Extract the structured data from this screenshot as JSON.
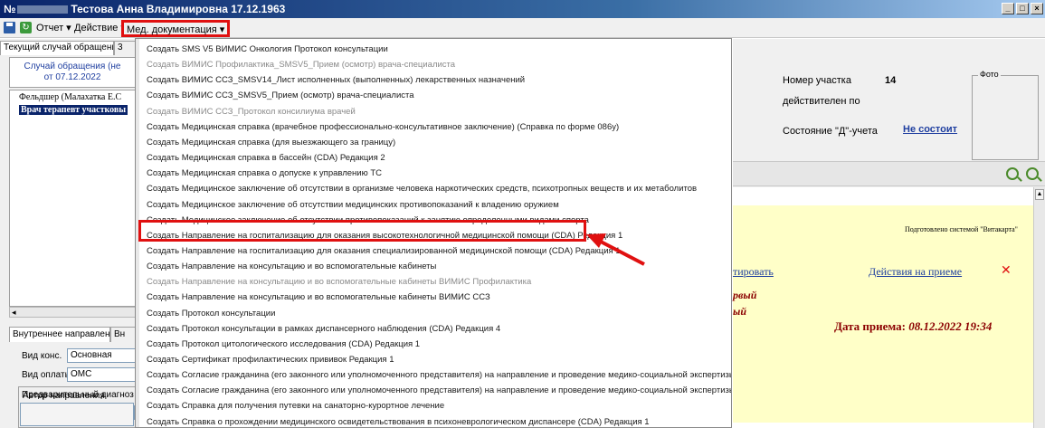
{
  "window": {
    "title_prefix": "№",
    "title_name": "Тестова Анна Владимировна 17.12.1963",
    "btn_min": "_",
    "btn_max": "□",
    "btn_close": "×"
  },
  "toolbar": {
    "report": "Отчет ▾",
    "action": "Действие ▾",
    "med_docs": "Мед. документация ▾",
    "refresh_glyph": "↻"
  },
  "left": {
    "tab_current": "Текущий случай обращения",
    "tab_current_2": "3",
    "case_line1": "Случай обращения (не",
    "case_line2": "от 07.12.2022",
    "tree_node1": "Фельдшер (Малахатка Е.С",
    "tree_node2": "Врач терапевт участковы",
    "hscroll_glyph": "◂",
    "tab_referral": "Внутреннее направление",
    "tab_referral_2": "Вн",
    "consult_type_label": "Вид конс.",
    "consult_type_value": "Основная",
    "payment_type_label": "Вид оплаты",
    "payment_type_value": "ОМС",
    "author_label": "Автор направления",
    "diagnosis_label": "Предварительный диагноз"
  },
  "right": {
    "district_label": "Номер участка",
    "district_value": "14",
    "valid_label": "действителен по",
    "d_status_label": "Состояние \"Д\"-учета",
    "d_status_value": "Не состоит",
    "photo_label": "Фото",
    "prepared_by": "Подготовлено системой \"Витакарта\"",
    "edit_link": "тировать",
    "actions_link": "Действия на приеме",
    "close_glyph": "✕",
    "primary_frag": "рвый",
    "frag2": "ый",
    "visit_date_label": "Дата приема:",
    "visit_date_value": "08.12.2022 19:34",
    "scroll_up_glyph": "▲"
  },
  "menu": {
    "items": [
      {
        "label": "Создать SMS V5 ВИМИС Онкология Протокол консультации",
        "disabled": false
      },
      {
        "label": "Создать ВИМИС Профилактика_SMSV5_Прием (осмотр) врача-специалиста",
        "disabled": true
      },
      {
        "label": "Создать ВИМИС ССЗ_SMSV14_Лист исполненных (выполненных) лекарственных назначений",
        "disabled": false
      },
      {
        "label": "Создать ВИМИС ССЗ_SMSV5_Прием (осмотр) врача-специалиста",
        "disabled": false
      },
      {
        "label": "Создать ВИМИС ССЗ_Протокол консилиума врачей",
        "disabled": true
      },
      {
        "label": "Создать Медицинская справка (врачебное профессионально-консультативное заключение) (Справка по форме 086у)",
        "disabled": false
      },
      {
        "label": "Создать Медицинская справка (для выезжающего за границу)",
        "disabled": false
      },
      {
        "label": "Создать Медицинская справка в бассейн (CDA) Редакция 2",
        "disabled": false
      },
      {
        "label": "Создать Медицинская справка о допуске к управлению ТС",
        "disabled": false
      },
      {
        "label": "Создать Медицинское заключение об отсутствии в организме человека наркотических средств, психотропных веществ и их метаболитов",
        "disabled": false
      },
      {
        "label": "Создать Медицинское заключение об отсутствии медицинских противопоказаний к владению оружием",
        "disabled": false
      },
      {
        "label": "Создать Медицинское заключение об отсутствии противопоказаний к занятию определенными видами спорта",
        "disabled": false
      },
      {
        "label": "Создать Направление на госпитализацию для оказания высокотехнологичной медицинской помощи (CDA) Редакция 1",
        "disabled": false
      },
      {
        "label": "Создать Направление на госпитализацию для оказания специализированной медицинской помощи (CDA) Редакция 1",
        "disabled": false
      },
      {
        "label": "Создать Направление на консультацию и во вспомогательные кабинеты",
        "disabled": false
      },
      {
        "label": "Создать Направление на консультацию и во вспомогательные кабинеты ВИМИС Профилактика",
        "disabled": true
      },
      {
        "label": "Создать Направление на консультацию и во вспомогательные кабинеты ВИМИС ССЗ",
        "disabled": false
      },
      {
        "label": "Создать Протокол консультации",
        "disabled": false
      },
      {
        "label": "Создать Протокол консультации в рамках диспансерного наблюдения (CDA) Редакция 4",
        "disabled": false
      },
      {
        "label": "Создать Протокол цитологического исследования (CDA) Редакция 1",
        "disabled": false
      },
      {
        "label": "Создать Сертификат профилактических прививок Редакция 1",
        "disabled": false
      },
      {
        "label": "Создать Согласие гражданина (его законного или уполномоченного представителя) на направление и проведение медико-социальной экспертизы пациент",
        "disabled": false
      },
      {
        "label": "Создать Согласие гражданина (его законного или уполномоченного представителя) на направление и проведение медико-социальной экспертизы с ЗП",
        "disabled": false
      },
      {
        "label": "Создать Справка для получения путевки на санаторно-курортное лечение",
        "disabled": false
      },
      {
        "label": "Создать Справка о прохождении медицинского освидетельствования в психоневрологическом диспансере (CDA) Редакция 1",
        "disabled": false
      }
    ]
  },
  "colors": {
    "highlight": "#e01010",
    "selection": "#0a246a",
    "doc_background": "#ffffc8",
    "link": "#1f3fa0",
    "date_red": "#8b0000"
  }
}
